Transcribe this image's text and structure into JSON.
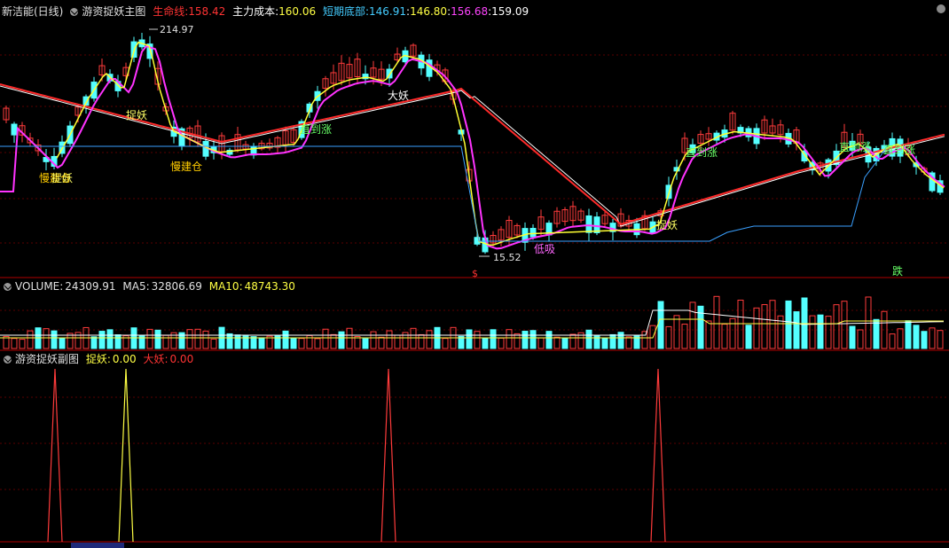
{
  "main": {
    "stock": "新洁能(日线)",
    "indicator": "游资捉妖主图",
    "life_label": "生命线:",
    "life_val": "158.42",
    "cost_label": "主力成本:",
    "cost_val": "160.06",
    "short_label": "短期底部:",
    "short_v1": "146.91",
    "short_sep1": ":",
    "short_v2": "146.80",
    "short_sep2": ":",
    "short_v3": "156.68",
    "short_sep3": ":",
    "short_v4": "159.09",
    "high_label": "214.97",
    "low_label": "15.52",
    "annotations": [
      {
        "text": "慢建仓"
      },
      {
        "text": "捉妖"
      },
      {
        "text": "捉妖"
      },
      {
        "text": "慢建仓"
      },
      {
        "text": "直到涨"
      },
      {
        "text": "大妖"
      },
      {
        "text": "低吸"
      },
      {
        "text": "捉妖"
      },
      {
        "text": "直到涨"
      },
      {
        "text": "直到涨"
      },
      {
        "text": "直到涨"
      },
      {
        "text": "跌"
      }
    ],
    "dollar_mark": "$"
  },
  "volume": {
    "label_name": "VOLUME:",
    "label_val": "24309.91",
    "ma5_label": "MA5:",
    "ma5_val": "32806.69",
    "ma10_label": "MA10:",
    "ma10_val": "48743.30"
  },
  "sub": {
    "indicator": "游资捉妖副图",
    "a_label": "捉妖:",
    "a_val": "0.00",
    "b_label": "大妖:",
    "b_val": "0.00"
  },
  "colors": {
    "up": "#ff3b3b",
    "down": "#54ffff",
    "life": "#ff2a2a",
    "cost": "#ffffff",
    "short": "#ff33ff",
    "fast": "#ffff33",
    "floor": "#3aa0ff",
    "grid": "#5a0000",
    "sep": "#b00000"
  },
  "chart_data": {
    "type": "candlestick",
    "series": [
      {
        "name": "生命线",
        "values_note": "red line",
        "values": []
      },
      {
        "name": "主力成本",
        "values": []
      },
      {
        "name": "短期底部",
        "values": []
      }
    ],
    "price_high": 214.97,
    "price_low": 15.52,
    "volume": {
      "VOLUME": 24309.91,
      "MA5": 32806.69,
      "MA10": 48743.3
    },
    "sub": {
      "捉妖": 0.0,
      "大妖": 0.0
    }
  }
}
